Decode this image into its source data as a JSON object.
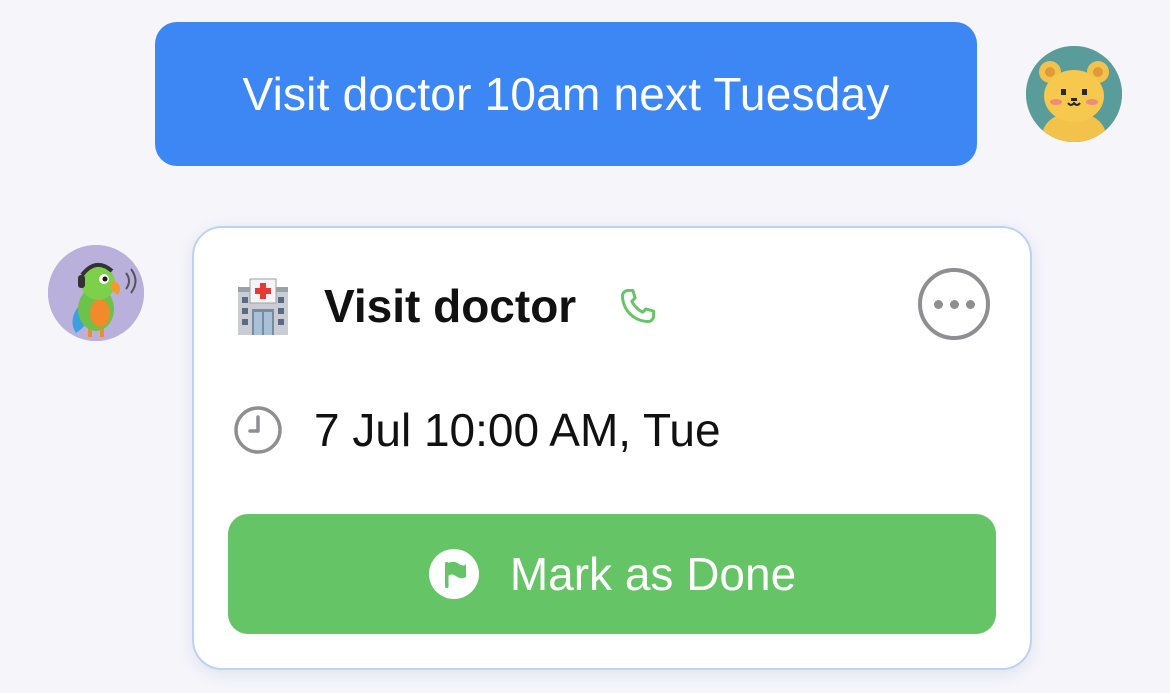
{
  "user_message": {
    "text": "Visit doctor 10am next Tuesday",
    "avatar_icon": "bear-avatar-icon"
  },
  "bot": {
    "avatar_icon": "parrot-avatar-icon"
  },
  "reminder_card": {
    "title": "Visit doctor",
    "category_icon": "hospital-icon",
    "call_icon": "phone-icon",
    "more_icon": "ellipsis-icon",
    "datetime": "7 Jul 10:00 AM, Tue",
    "datetime_icon": "clock-icon",
    "done_label": "Mark as Done",
    "done_icon": "flag-icon"
  },
  "colors": {
    "background": "#f5f5fa",
    "user_bubble": "#3d87f5",
    "card_border": "#bdd3f2",
    "done_button": "#65c466",
    "phone_icon": "#65c466",
    "muted_icon": "#8e8e93"
  }
}
